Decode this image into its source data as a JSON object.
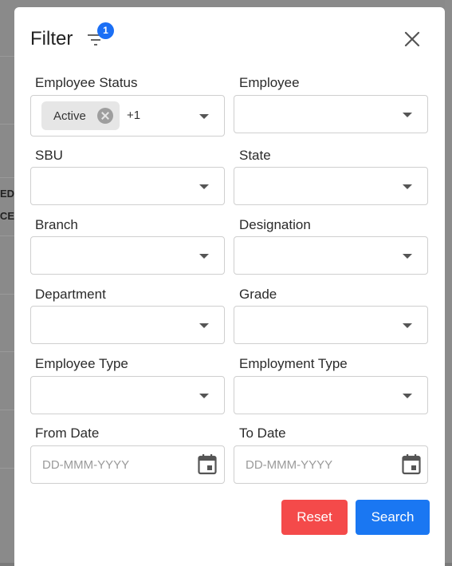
{
  "background": {
    "row_text_1": "TED",
    "row_text_2": "NCE"
  },
  "modal": {
    "title": "Filter",
    "filter_badge_count": "1"
  },
  "fields": {
    "employee_status": {
      "label": "Employee Status",
      "chip_label": "Active",
      "more_count": "+1"
    },
    "employee": {
      "label": "Employee"
    },
    "sbu": {
      "label": "SBU"
    },
    "state": {
      "label": "State"
    },
    "branch": {
      "label": "Branch"
    },
    "designation": {
      "label": "Designation"
    },
    "department": {
      "label": "Department"
    },
    "grade": {
      "label": "Grade"
    },
    "employee_type": {
      "label": "Employee Type"
    },
    "employment_type": {
      "label": "Employment Type"
    },
    "from_date": {
      "label": "From Date",
      "placeholder": "DD-MMM-YYYY"
    },
    "to_date": {
      "label": "To Date",
      "placeholder": "DD-MMM-YYYY"
    }
  },
  "buttons": {
    "reset": "Reset",
    "search": "Search"
  },
  "colors": {
    "badge": "#1b6ff5",
    "reset": "#f44a4a",
    "search": "#1a77f2"
  }
}
